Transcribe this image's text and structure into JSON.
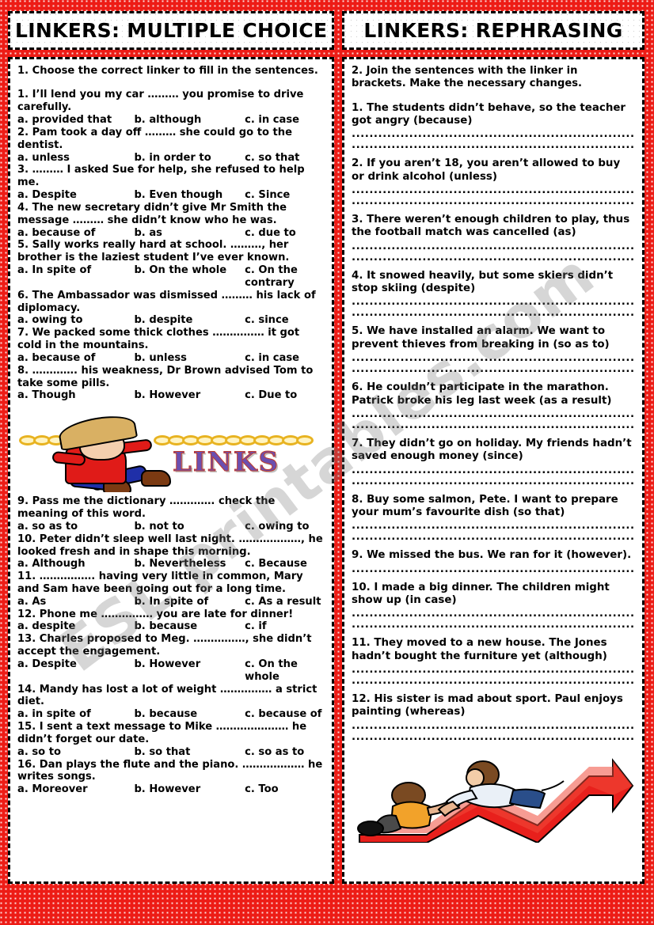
{
  "theme": {
    "border_color": "#ED1C16",
    "card_bg": "#FFFFFF",
    "text_color": "#000000"
  },
  "watermark": "ESL printables.com",
  "left_panel": {
    "title": "LINKERS: MULTIPLE CHOICE",
    "instruction": "1. Choose the correct linker to fill in the sentences.",
    "questions": [
      {
        "text": "1. I’ll lend you my car ……… you promise to drive carefully.",
        "a": "a. provided that",
        "b": "b. although",
        "c": "c. in case"
      },
      {
        "text": "2. Pam took a day off ……… she could go to the dentist.",
        "a": "a. unless",
        "b": "b. in order to",
        "c": "c. so that"
      },
      {
        "text": "3. ……… I asked Sue for help, she refused to help me.",
        "a": "a. Despite",
        "b": "b. Even though",
        "c": "c. Since"
      },
      {
        "text": "4. The new secretary didn’t give Mr Smith the message ……… she didn’t know who he was.",
        "a": "a. because of",
        "b": "b. as",
        "c": "c. due to"
      },
      {
        "text": "5. Sally works really hard at school. ………, her brother is the laziest student I’ve ever known.",
        "a": "a. In spite of",
        "b": "b. On the whole",
        "c": "c. On the contrary"
      },
      {
        "text": "6. The Ambassador was dismissed ……… his lack of diplomacy.",
        "a": "a. owing to",
        "b": "b. despite",
        "c": "c. since"
      },
      {
        "text": "7. We packed some thick clothes …………… it got cold in the mountains.",
        "a": "a. because of",
        "b": "b. unless",
        "c": "c. in case"
      },
      {
        "text": "8. …………. his weakness, Dr Brown advised Tom to take some pills.",
        "a": "a. Though",
        "b": "b. However",
        "c": "c. Due to"
      }
    ],
    "questions_after_image": [
      {
        "text": "9. Pass me the dictionary …………. check the meaning of this word.",
        "a": "a. so as to",
        "b": "b. not to",
        "c": "c. owing to"
      },
      {
        "text": "10. Peter didn’t sleep well last night. ………………, he looked fresh and in shape this morning.",
        "a": "a. Although",
        "b": "b. Nevertheless",
        "c": "c. Because"
      },
      {
        "text": "11. ……………. having very little in common, Mary and Sam have been going out for a long time.",
        "a": "a. As",
        "b": "b. In spite of",
        "c": "c. As a result"
      },
      {
        "text": "12. Phone me …………… you are late for dinner!",
        "a": "a. despite",
        "b": "b. because",
        "c": "c. if"
      },
      {
        "text": "13. Charles proposed to Meg. ……………, she didn’t accept the engagement.",
        "a": "a. Despite",
        "b": "b. However",
        "c": "c. On the whole"
      },
      {
        "text": "14. Mandy has lost a lot of weight …………… a strict diet.",
        "a": "a. in spite of",
        "b": "b. because",
        "c": "c. because of"
      },
      {
        "text": "15. I sent a text message to Mike ………………… he didn’t forget our date.",
        "a": "a. so to",
        "b": "b. so that",
        "c": "c. so as to"
      },
      {
        "text": "16. Dan plays the flute and the piano. ……………… he writes songs.",
        "a": "a. Moreover",
        "b": "b. However",
        "c": "c. Too"
      }
    ],
    "clipart": {
      "name": "man-pulling-chain",
      "word": "LINKS"
    }
  },
  "right_panel": {
    "title": "LINKERS: REPHRASING",
    "instruction": "2. Join the sentences with the linker in brackets. Make the necessary changes.",
    "answer_line": "....................................................................",
    "questions": [
      "1. The students didn’t behave, so the teacher got angry (because)",
      "2. If you aren’t 18, you aren’t allowed to buy or drink alcohol (unless)",
      "3. There weren’t enough children to play, thus the football match was cancelled (as)",
      "4. It snowed heavily, but some skiers didn’t stop skiing (despite)",
      "5. We have installed an alarm. We want to prevent thieves from breaking in (so as to)",
      "6. He couldn’t participate in the marathon. Patrick broke his leg last week (as a result)",
      "7. They didn’t go on holiday. My friends hadn’t saved enough money (since)",
      "8. Buy some salmon, Pete. I want to prepare your mum’s favourite dish (so that)",
      "9. We missed the bus. We ran for it (however).",
      "10. I made a big dinner. The children might show up (in case)",
      "11. They moved to a new house. The Jones hadn’t bought the furniture yet (although)",
      "12. His sister is mad about sport. Paul enjoys painting (whereas)"
    ],
    "clipart": {
      "name": "helping-hand-up-arrow"
    }
  }
}
